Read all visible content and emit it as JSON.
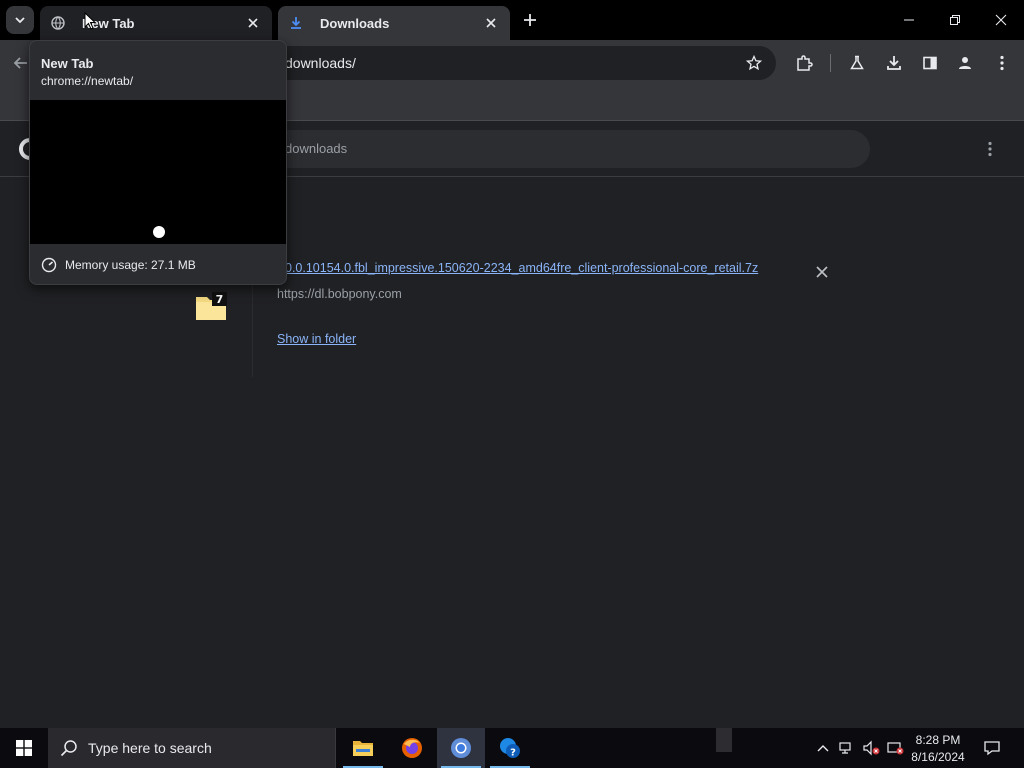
{
  "tabs": [
    {
      "title": "New Tab",
      "favicon": "globe-icon"
    },
    {
      "title": "Downloads",
      "favicon": "download-icon"
    }
  ],
  "toolbar": {
    "address_text": "downloads/"
  },
  "downloads_page": {
    "search_placeholder": "downloads"
  },
  "download_item": {
    "filename": "0.0.10154.0.fbl_impressive.150620-2234_amd64fre_client-professional-core_retail.7z",
    "source_url": "https://dl.bobpony.com",
    "show_in_folder": "Show in folder"
  },
  "hover_card": {
    "title": "New Tab",
    "url": "chrome://newtab/",
    "memory": "Memory usage: 27.1 MB"
  },
  "taskbar": {
    "search_placeholder": "Type here to search",
    "time": "8:28 PM",
    "date": "8/16/2024"
  },
  "colors": {
    "accent_link": "#8ab4f8",
    "page_bg": "#202124",
    "toolbar_bg": "#35363a"
  }
}
